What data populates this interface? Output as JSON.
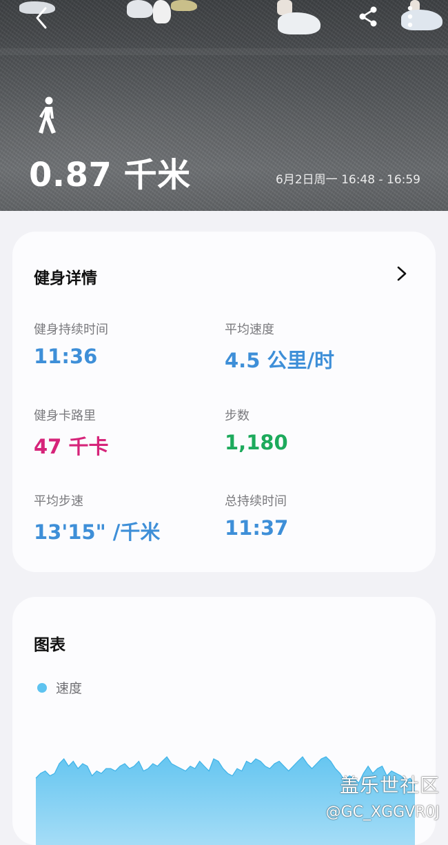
{
  "header": {
    "activity_icon": "walking-person-icon",
    "distance": "0.87 千米",
    "date_range": "6月2日周一 16:48 - 16:59",
    "icons": {
      "back": "chevron-left-icon",
      "share": "share-icon",
      "more": "more-vertical-icon"
    }
  },
  "details": {
    "title": "健身详情",
    "metrics": [
      {
        "label": "健身持续时间",
        "value": "11:36",
        "color": "#3e8fd8"
      },
      {
        "label": "平均速度",
        "value": "4.5 公里/时",
        "color": "#3e8fd8"
      },
      {
        "label": "健身卡路里",
        "value": "47 千卡",
        "color": "#d6247a"
      },
      {
        "label": "步数",
        "value": "1,180",
        "color": "#1daa5c"
      },
      {
        "label": "平均步速",
        "value": "13'15\" /千米",
        "color": "#3e8fd8"
      },
      {
        "label": "总持续时间",
        "value": "11:37",
        "color": "#3e8fd8"
      }
    ]
  },
  "chart": {
    "title": "图表",
    "legend": {
      "label": "速度",
      "color": "#5ec3f0"
    }
  },
  "chart_data": {
    "type": "area",
    "series": [
      {
        "name": "速度",
        "color": "#5ec3f0",
        "values": [
          3.9,
          4.1,
          4.2,
          4.0,
          4.1,
          4.5,
          4.7,
          4.4,
          4.6,
          4.3,
          4.5,
          4.4,
          4.0,
          4.2,
          4.1,
          4.3,
          4.3,
          4.2,
          4.4,
          4.5,
          4.3,
          4.4,
          4.6,
          4.2,
          4.3,
          4.5,
          4.4,
          4.6,
          4.8,
          4.5,
          4.4,
          4.3,
          4.2,
          4.4,
          4.3,
          4.6,
          4.4,
          4.2,
          4.7,
          4.6,
          4.3,
          4.1,
          4.0,
          4.3,
          4.2,
          4.6,
          4.5,
          4.7,
          4.6,
          4.4,
          4.3,
          4.5,
          4.6,
          4.4,
          4.2,
          4.4,
          4.6,
          4.8,
          4.5,
          4.3,
          4.5,
          4.7,
          4.9,
          4.6,
          4.3,
          4.1,
          3.8,
          4.0,
          3.9,
          3.7,
          4.1,
          4.4,
          4.1,
          4.3,
          4.4,
          4.0,
          4.2,
          4.1,
          4.0,
          3.8,
          3.9,
          3.6
        ]
      }
    ],
    "ylim": [
      0,
      6
    ]
  },
  "watermark": {
    "line1": "盖乐世社区",
    "line2": "@GC_XGGVR0J"
  }
}
